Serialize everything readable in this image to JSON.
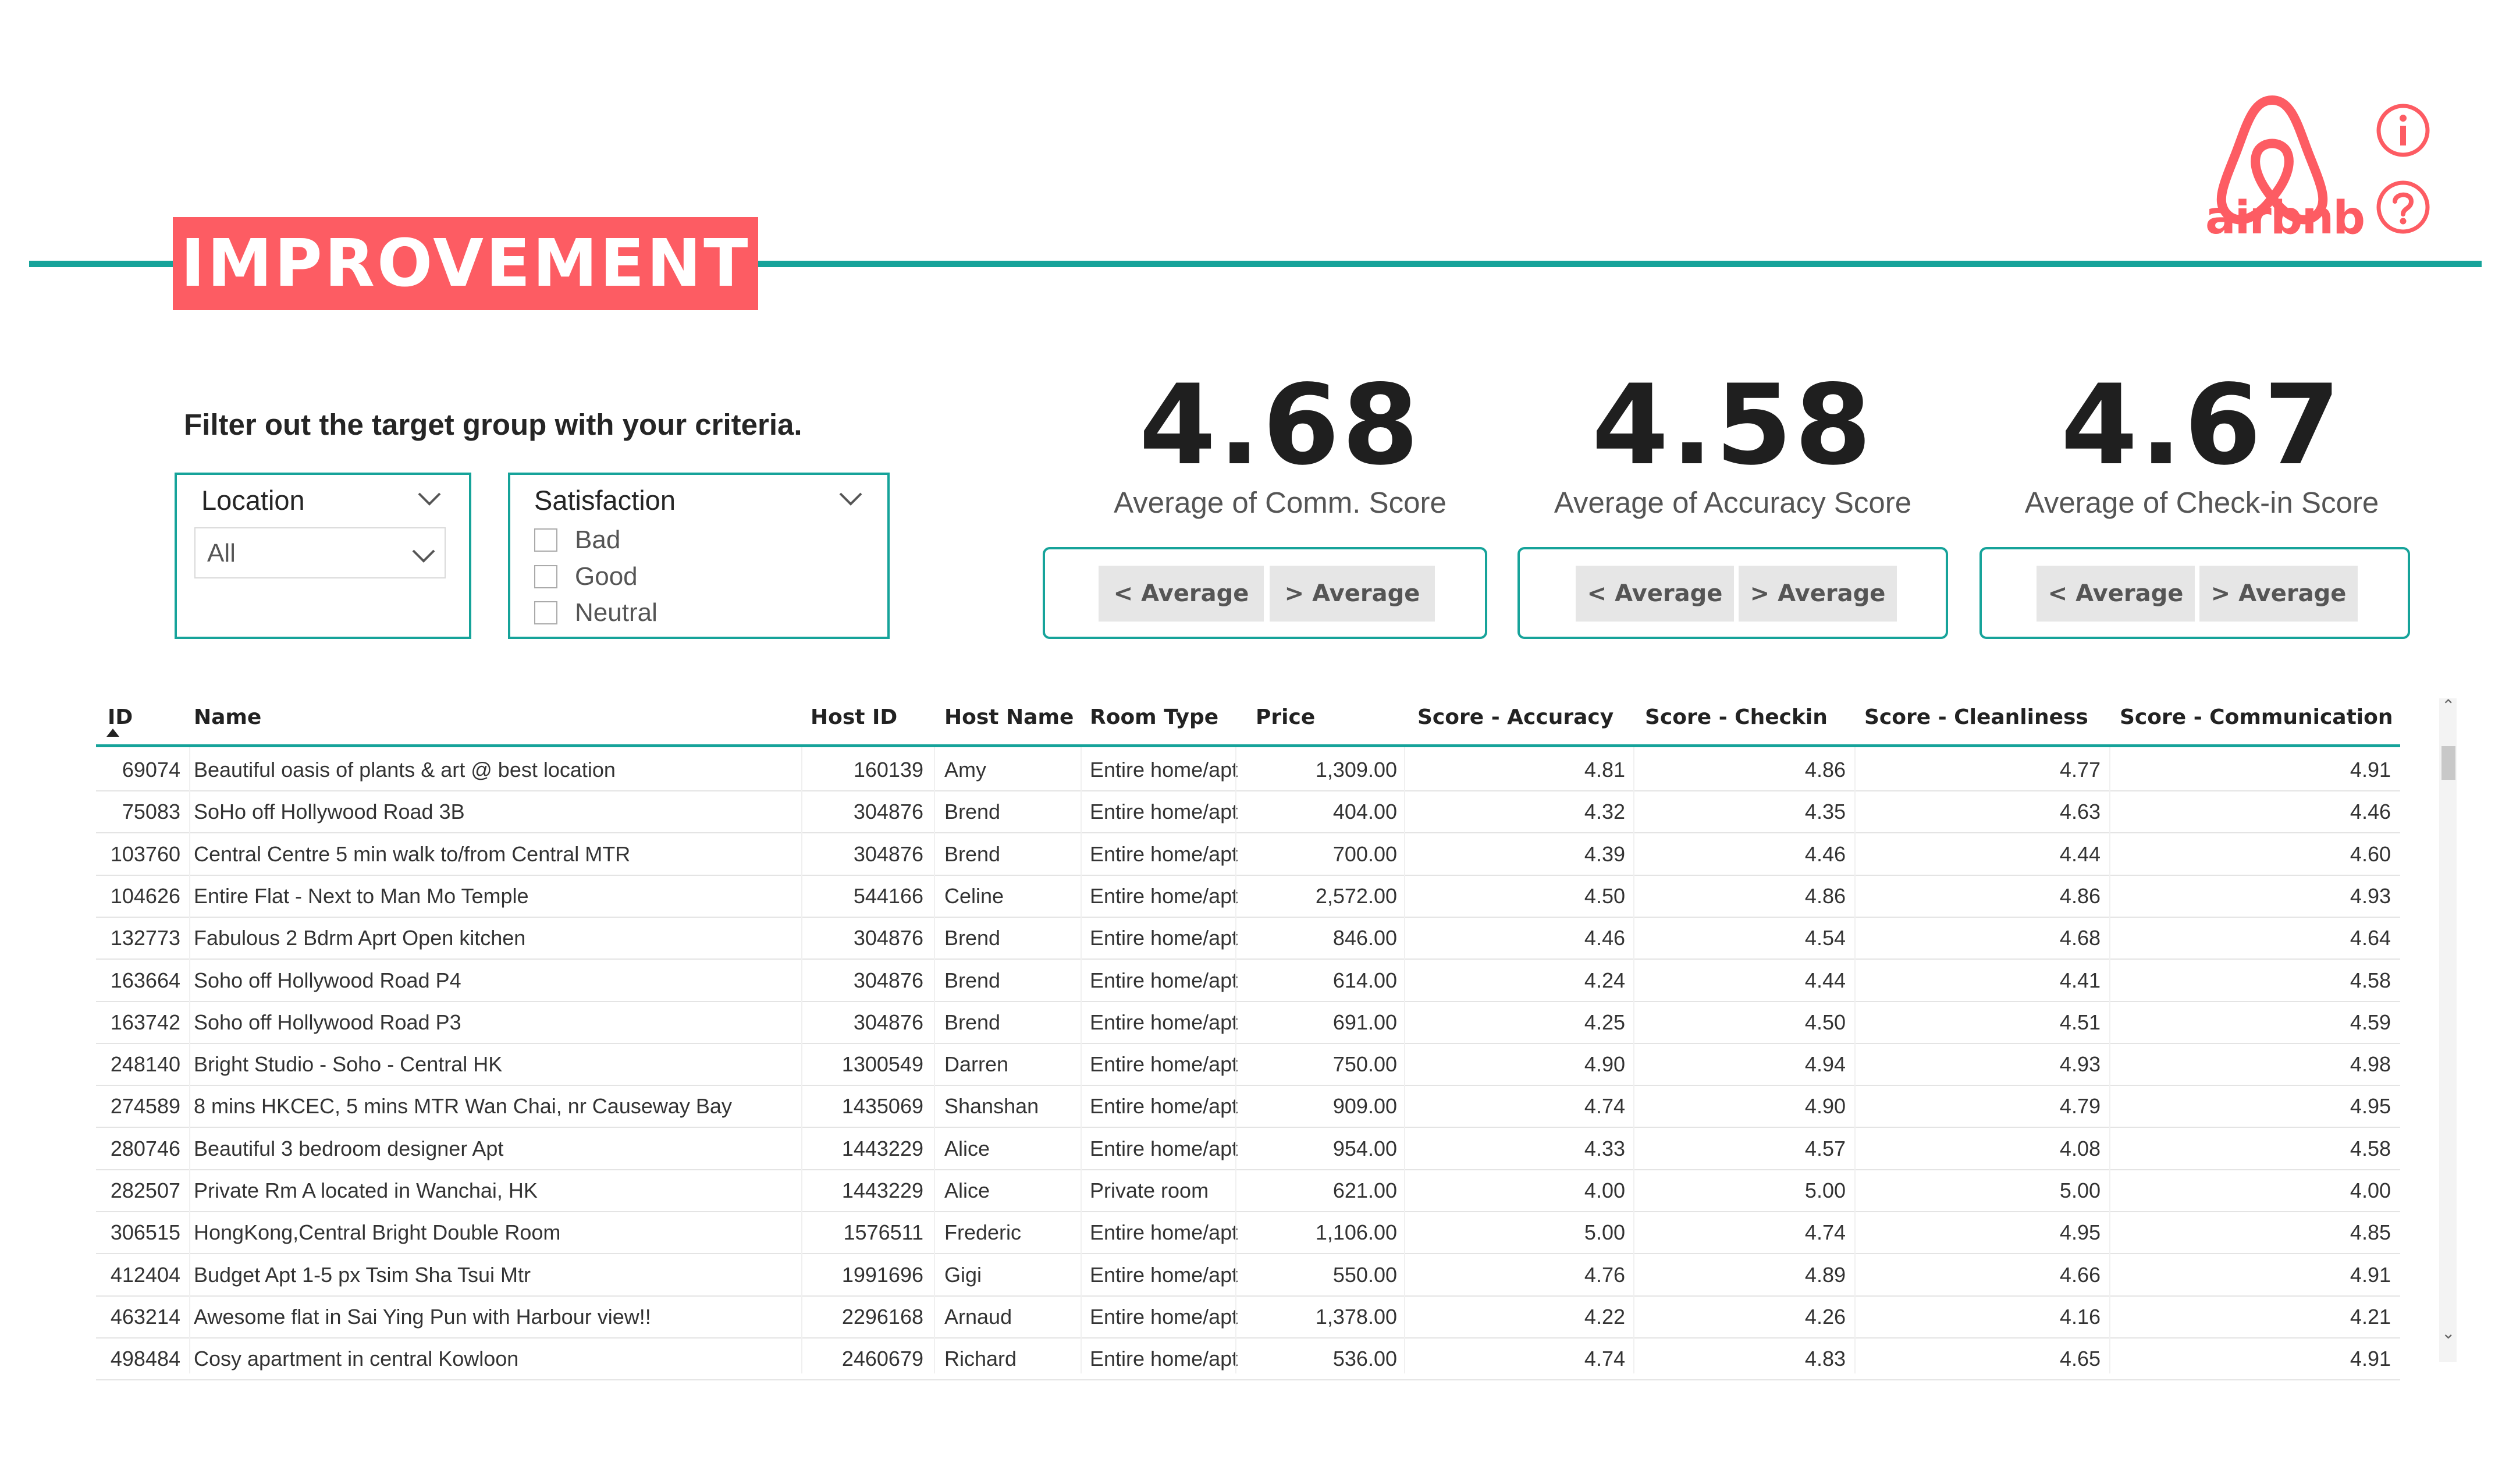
{
  "header": {
    "title": "IMPROVEMENT",
    "logo_text": "airbnb"
  },
  "colors": {
    "accent": "#16a39a",
    "brand": "#fd5c63"
  },
  "icons": {
    "info": "info-icon",
    "help": "help-icon",
    "logo": "airbnb-logo-icon"
  },
  "filter": {
    "label": "Filter out the target group with your criteria.",
    "location": {
      "title": "Location",
      "value": "All"
    },
    "satisfaction": {
      "title": "Satisfaction",
      "options": [
        "Bad",
        "Good",
        "Neutral"
      ]
    }
  },
  "kpis": [
    {
      "value": "4.68",
      "label": "Average of Comm. Score",
      "below": "< Average",
      "above": "> Average"
    },
    {
      "value": "4.58",
      "label": "Average of Accuracy Score",
      "below": "< Average",
      "above": "> Average"
    },
    {
      "value": "4.67",
      "label": "Average of Check-in Score",
      "below": "< Average",
      "above": "> Average"
    }
  ],
  "table": {
    "columns": [
      "ID",
      "Name",
      "Host ID",
      "Host Name",
      "Room Type",
      "Price",
      "Score - Accuracy",
      "Score - Checkin",
      "Score - Cleanliness",
      "Score - Communication"
    ],
    "rows": [
      [
        "69074",
        "Beautiful oasis of plants & art @ best location",
        "160139",
        "Amy",
        "Entire home/apt",
        "1,309.00",
        "4.81",
        "4.86",
        "4.77",
        "4.91"
      ],
      [
        "75083",
        "SoHo off Hollywood Road 3B",
        "304876",
        "Brend",
        "Entire home/apt",
        "404.00",
        "4.32",
        "4.35",
        "4.63",
        "4.46"
      ],
      [
        "103760",
        "Central Centre 5 min walk to/from Central MTR",
        "304876",
        "Brend",
        "Entire home/apt",
        "700.00",
        "4.39",
        "4.46",
        "4.44",
        "4.60"
      ],
      [
        "104626",
        "Entire Flat - Next to Man Mo Temple",
        "544166",
        "Celine",
        "Entire home/apt",
        "2,572.00",
        "4.50",
        "4.86",
        "4.86",
        "4.93"
      ],
      [
        "132773",
        "Fabulous 2 Bdrm Aprt Open kitchen",
        "304876",
        "Brend",
        "Entire home/apt",
        "846.00",
        "4.46",
        "4.54",
        "4.68",
        "4.64"
      ],
      [
        "163664",
        "Soho off Hollywood Road P4",
        "304876",
        "Brend",
        "Entire home/apt",
        "614.00",
        "4.24",
        "4.44",
        "4.41",
        "4.58"
      ],
      [
        "163742",
        "Soho off Hollywood Road P3",
        "304876",
        "Brend",
        "Entire home/apt",
        "691.00",
        "4.25",
        "4.50",
        "4.51",
        "4.59"
      ],
      [
        "248140",
        "Bright Studio - Soho - Central HK",
        "1300549",
        "Darren",
        "Entire home/apt",
        "750.00",
        "4.90",
        "4.94",
        "4.93",
        "4.98"
      ],
      [
        "274589",
        "8 mins HKCEC, 5 mins MTR Wan Chai, nr Causeway Bay",
        "1435069",
        "Shanshan",
        "Entire home/apt",
        "909.00",
        "4.74",
        "4.90",
        "4.79",
        "4.95"
      ],
      [
        "280746",
        "Beautiful 3 bedroom designer Apt",
        "1443229",
        "Alice",
        "Entire home/apt",
        "954.00",
        "4.33",
        "4.57",
        "4.08",
        "4.58"
      ],
      [
        "282507",
        "Private Rm A located in Wanchai, HK",
        "1443229",
        "Alice",
        "Private room",
        "621.00",
        "4.00",
        "5.00",
        "5.00",
        "4.00"
      ],
      [
        "306515",
        "HongKong,Central Bright Double Room",
        "1576511",
        "Frederic",
        "Entire home/apt",
        "1,106.00",
        "5.00",
        "4.74",
        "4.95",
        "4.85"
      ],
      [
        "412404",
        "Budget Apt 1-5 px Tsim Sha Tsui Mtr",
        "1991696",
        "Gigi",
        "Entire home/apt",
        "550.00",
        "4.76",
        "4.89",
        "4.66",
        "4.91"
      ],
      [
        "463214",
        "Awesome flat in Sai Ying Pun with Harbour view!!",
        "2296168",
        "Arnaud",
        "Entire home/apt",
        "1,378.00",
        "4.22",
        "4.26",
        "4.16",
        "4.21"
      ],
      [
        "498484",
        "Cosy apartment in central Kowloon",
        "2460679",
        "Richard",
        "Entire home/apt",
        "536.00",
        "4.74",
        "4.83",
        "4.65",
        "4.91"
      ]
    ]
  }
}
